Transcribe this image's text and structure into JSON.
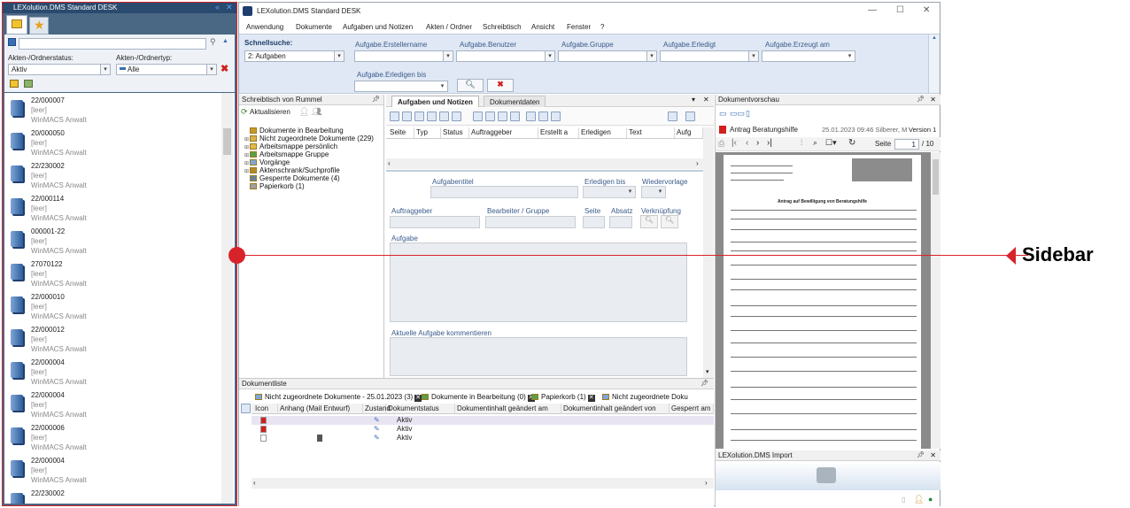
{
  "sidebar": {
    "title": "LEXolution.DMS Standard DESK",
    "status_label": "Akten-/Ordnerstatus:",
    "status_value": "Aktiv",
    "type_label": "Akten-/Ordnertyp:",
    "type_value": "Alle",
    "items": [
      {
        "number": "22/000007",
        "line2": "[leer]",
        "line3": "WinMACS Anwalt"
      },
      {
        "number": "20/000050",
        "line2": "[leer]",
        "line3": "WinMACS Anwalt"
      },
      {
        "number": "22/230002",
        "line2": "[leer]",
        "line3": "WinMACS Anwalt"
      },
      {
        "number": "22/000114",
        "line2": "[leer]",
        "line3": "WinMACS Anwalt"
      },
      {
        "number": "000001-22",
        "line2": "[leer]",
        "line3": "WinMACS Anwalt"
      },
      {
        "number": "27070122",
        "line2": "[leer]",
        "line3": "WinMACS Anwalt"
      },
      {
        "number": "22/000010",
        "line2": "[leer]",
        "line3": "WinMACS Anwalt"
      },
      {
        "number": "22/000012",
        "line2": "[leer]",
        "line3": "WinMACS Anwalt"
      },
      {
        "number": "22/000004",
        "line2": "[leer]",
        "line3": "WinMACS Anwalt"
      },
      {
        "number": "22/000004",
        "line2": "[leer]",
        "line3": "WinMACS Anwalt"
      },
      {
        "number": "22/000006",
        "line2": "[leer]",
        "line3": "WinMACS Anwalt"
      },
      {
        "number": "22/000004",
        "line2": "[leer]",
        "line3": "WinMACS Anwalt"
      },
      {
        "number": "22/230002",
        "line2": "",
        "line3": ""
      }
    ]
  },
  "window": {
    "title": "LEXolution.DMS Standard DESK",
    "controls": {
      "minimize": "—",
      "maximize": "☐",
      "close": "✕"
    }
  },
  "menu": [
    "Anwendung",
    "Dokumente",
    "Aufgaben und Notizen",
    "Akten / Ordner",
    "Schreibtisch",
    "Ansicht",
    "Fenster",
    "?"
  ],
  "quicksearch": {
    "label": "Schnellsuche:",
    "value": "2: Aufgaben",
    "fields": [
      "Aufgabe.Erstellername",
      "Aufgabe.Benutzer",
      "Aufgabe.Gruppe",
      "Aufgabe.Erledigt",
      "Aufgabe.Erzeugt am",
      "Aufgabe.Erledigen bis"
    ]
  },
  "desk": {
    "title": "Schreibtisch von Rummel",
    "refresh": "Aktualisieren",
    "tree": [
      "Dokumente in Bearbeitung",
      "Nicht zugeordnete Dokumente (229)",
      "Arbeitsmappe persönlich",
      "Arbeitsmappe Gruppe",
      "Vorgänge",
      "Aktenschrank/Suchprofile",
      "Gesperrte Dokumente (4)",
      "Papierkorb (1)"
    ]
  },
  "tasks": {
    "tabs": [
      "Aufgaben und Notizen",
      "Dokumentdaten"
    ],
    "columns": [
      "Seite",
      "Typ",
      "Status",
      "Auftraggeber",
      "Erstellt a",
      "Erledigen",
      "Text",
      "Aufg"
    ],
    "labels": {
      "title": "Aufgabentitel",
      "due": "Erledigen bis",
      "resubmit": "Wiedervorlage",
      "client": "Auftraggeber",
      "editor": "Bearbeiter / Gruppe",
      "page": "Seite",
      "para": "Absatz",
      "link": "Verknüpfung",
      "task": "Aufgabe",
      "comment": "Aktuelle Aufgabe kommentieren"
    }
  },
  "doclist": {
    "title": "Dokumentliste",
    "tabs": [
      "Nicht zugeordnete Dokumente - 25.01.2023 (3)",
      "Dokumente in Bearbeitung (0)",
      "Papierkorb (1)",
      "Nicht zugeordnete Doku"
    ],
    "columns": [
      "Icon",
      "Anhang (Mail Entwurf)",
      "Zustand",
      "Dokumentstatus",
      "Dokumentinhalt geändert am",
      "Dokumentinhalt geändert von",
      "Gesperrt am"
    ],
    "rows": [
      {
        "status": "Aktiv"
      },
      {
        "status": "Aktiv"
      },
      {
        "status": "Aktiv"
      }
    ]
  },
  "preview": {
    "title": "Dokumentvorschau",
    "doc_name": "Antrag Beratungshilfe",
    "doc_meta": "25.01.2023 09:46 Silberer, M",
    "version": "Version 1",
    "page_label": "Seite",
    "page_value": "1",
    "page_total": "/ 10",
    "page_heading": "Antrag auf Bewilligung von Beratungshilfe"
  },
  "import": {
    "title": "LEXolution.DMS Import"
  },
  "annotation": {
    "label": "Sidebar",
    "color": "#d8232a"
  }
}
